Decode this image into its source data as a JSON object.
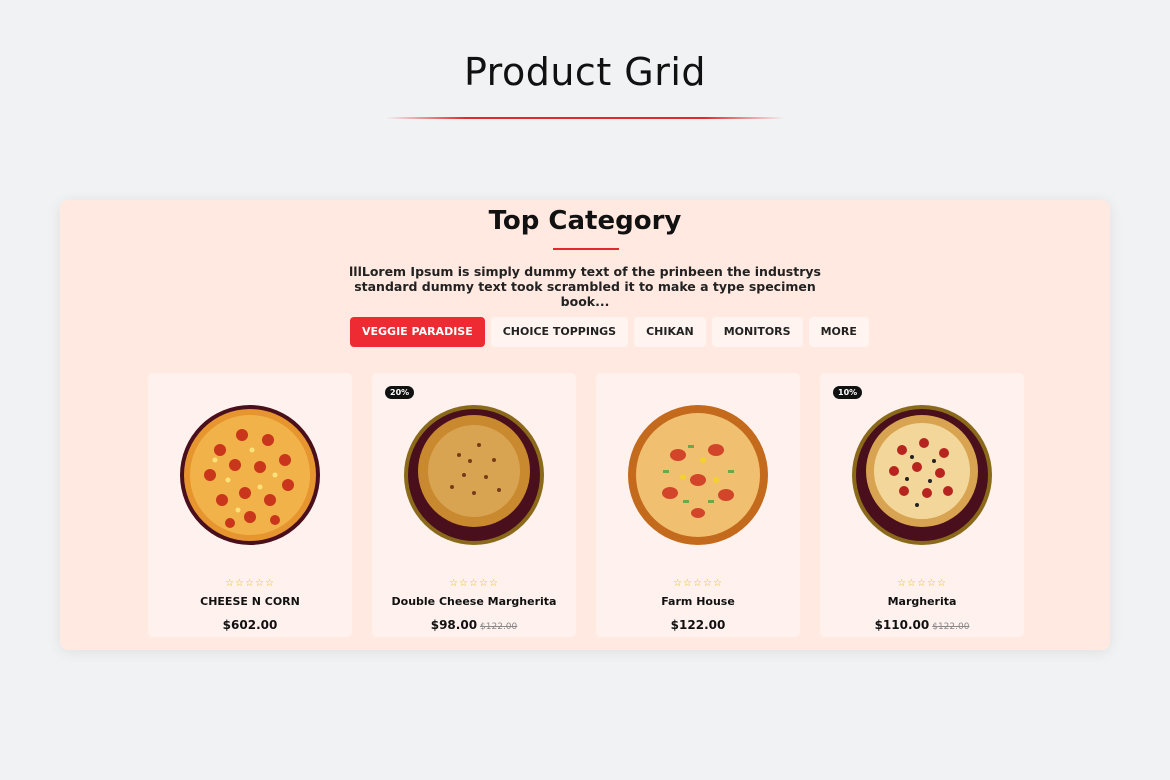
{
  "page_title": "Product Grid",
  "section": {
    "title": "Top Category",
    "description_line1": "lllLorem Ipsum is simply dummy text of the prinbeen the industrys",
    "description_line2": "standard dummy text took scrambled it to make a type specimen book..."
  },
  "tabs": [
    {
      "label": "VEGGIE PARADISE",
      "active": true
    },
    {
      "label": "CHOICE TOPPINGS",
      "active": false
    },
    {
      "label": "CHIKAN",
      "active": false
    },
    {
      "label": "MONITORS",
      "active": false
    },
    {
      "label": "MORE",
      "active": false
    }
  ],
  "products": [
    {
      "name": "CHEESE N CORN",
      "price": "$602.00",
      "old_price": "",
      "badge": "",
      "rating": "☆☆☆☆☆"
    },
    {
      "name": "Double Cheese Margherita",
      "price": "$98.00",
      "old_price": "$122.00",
      "badge": "20%",
      "rating": "☆☆☆☆☆"
    },
    {
      "name": "Farm House",
      "price": "$122.00",
      "old_price": "",
      "badge": "",
      "rating": "☆☆☆☆☆"
    },
    {
      "name": "Margherita",
      "price": "$110.00",
      "old_price": "$122.00",
      "badge": "10%",
      "rating": "☆☆☆☆☆"
    }
  ],
  "colors": {
    "accent": "#ee2a33",
    "panel_bg": "#ffe9e0",
    "star": "#d9c400"
  }
}
